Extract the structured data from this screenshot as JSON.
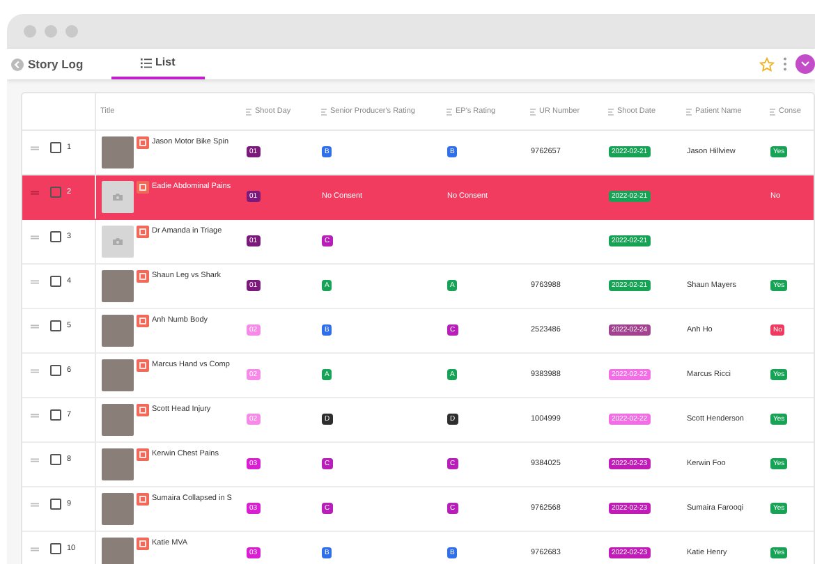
{
  "header": {
    "back_label": "Story Log",
    "tabs": [
      {
        "label": "List",
        "selected": true
      }
    ]
  },
  "table": {
    "columns": [
      {
        "label": "Title",
        "kind": "primary"
      },
      {
        "label": "Shoot Day",
        "kind": "field"
      },
      {
        "label": "Senior Producer's Rating",
        "kind": "field"
      },
      {
        "label": "EP's Rating",
        "kind": "field"
      },
      {
        "label": "UR Number",
        "kind": "field"
      },
      {
        "label": "Shoot Date",
        "kind": "field"
      },
      {
        "label": "Patient Name",
        "kind": "field"
      },
      {
        "label": "Conse",
        "kind": "field"
      }
    ],
    "rows": [
      {
        "number": "1",
        "checked": false,
        "highlighted": false,
        "thumbnail": {
          "kind": "photo"
        },
        "title": "Jason Motor Bike Spin",
        "shoot_day": {
          "text": "01",
          "color": "#7b1a7b"
        },
        "sp_rating": {
          "text": "B",
          "color": "#2f6fea"
        },
        "ep_rating": {
          "text": "B",
          "color": "#2f6fea"
        },
        "ur_number": "9762657",
        "shoot_date": {
          "text": "2022-02-21",
          "color": "#17a255"
        },
        "patient_name": "Jason Hillview",
        "consent": {
          "text": "Yes",
          "color": "#17a255"
        }
      },
      {
        "number": "2",
        "checked": false,
        "highlighted": true,
        "thumbnail": {
          "kind": "empty"
        },
        "title": "Eadie Abdominal Pains",
        "shoot_day": {
          "text": "01",
          "color": "#7b1a7b"
        },
        "sp_rating": {
          "text": "No Consent"
        },
        "ep_rating": {
          "text": "No Consent"
        },
        "shoot_date": {
          "text": "2022-02-21",
          "color": "#17a255"
        },
        "consent": {
          "text": "No"
        }
      },
      {
        "number": "3",
        "checked": false,
        "highlighted": false,
        "thumbnail": {
          "kind": "empty"
        },
        "title": "Dr Amanda in Triage",
        "shoot_day": {
          "text": "01",
          "color": "#7b1a7b"
        },
        "sp_rating": {
          "text": "C",
          "color": "#b81fb8"
        },
        "shoot_date": {
          "text": "2022-02-21",
          "color": "#17a255"
        }
      },
      {
        "number": "4",
        "checked": false,
        "highlighted": false,
        "thumbnail": {
          "kind": "photo"
        },
        "title": "Shaun Leg vs Shark",
        "shoot_day": {
          "text": "01",
          "color": "#7b1a7b"
        },
        "sp_rating": {
          "text": "A",
          "color": "#17a255"
        },
        "ep_rating": {
          "text": "A",
          "color": "#17a255"
        },
        "ur_number": "9763988",
        "shoot_date": {
          "text": "2022-02-21",
          "color": "#17a255"
        },
        "patient_name": "Shaun Mayers",
        "consent": {
          "text": "Yes",
          "color": "#17a255"
        }
      },
      {
        "number": "5",
        "checked": false,
        "highlighted": false,
        "thumbnail": {
          "kind": "photo"
        },
        "title": "Anh Numb Body",
        "shoot_day": {
          "text": "02",
          "color": "#f78ae8"
        },
        "sp_rating": {
          "text": "B",
          "color": "#2f6fea"
        },
        "ep_rating": {
          "text": "C",
          "color": "#b81fb8"
        },
        "ur_number": "2523486",
        "shoot_date": {
          "text": "2022-02-24",
          "color": "#a3428f"
        },
        "patient_name": "Anh Ho",
        "consent": {
          "text": "No",
          "color": "#f0395f"
        }
      },
      {
        "number": "6",
        "checked": false,
        "highlighted": false,
        "thumbnail": {
          "kind": "photo"
        },
        "title": "Marcus Hand vs Comp",
        "shoot_day": {
          "text": "02",
          "color": "#f78ae8"
        },
        "sp_rating": {
          "text": "A",
          "color": "#17a255"
        },
        "ep_rating": {
          "text": "A",
          "color": "#17a255"
        },
        "ur_number": "9383988",
        "shoot_date": {
          "text": "2022-02-22",
          "color": "#f26ee6"
        },
        "patient_name": "Marcus Ricci",
        "consent": {
          "text": "Yes",
          "color": "#17a255"
        }
      },
      {
        "number": "7",
        "checked": false,
        "highlighted": false,
        "thumbnail": {
          "kind": "photo"
        },
        "title": "Scott Head Injury",
        "shoot_day": {
          "text": "02",
          "color": "#f78ae8"
        },
        "sp_rating": {
          "text": "D",
          "color": "#2e2e2e"
        },
        "ep_rating": {
          "text": "D",
          "color": "#2e2e2e"
        },
        "ur_number": "1004999",
        "shoot_date": {
          "text": "2022-02-22",
          "color": "#f26ee6"
        },
        "patient_name": "Scott Henderson",
        "consent": {
          "text": "Yes",
          "color": "#17a255"
        }
      },
      {
        "number": "8",
        "checked": false,
        "highlighted": false,
        "thumbnail": {
          "kind": "photo"
        },
        "title": "Kerwin Chest Pains",
        "shoot_day": {
          "text": "03",
          "color": "#d81fd2"
        },
        "sp_rating": {
          "text": "C",
          "color": "#b81fb8"
        },
        "ep_rating": {
          "text": "C",
          "color": "#b81fb8"
        },
        "ur_number": "9384025",
        "shoot_date": {
          "text": "2022-02-23",
          "color": "#c21cb8"
        },
        "patient_name": "Kerwin Foo",
        "consent": {
          "text": "Yes",
          "color": "#17a255"
        }
      },
      {
        "number": "9",
        "checked": false,
        "highlighted": false,
        "thumbnail": {
          "kind": "photo"
        },
        "title": "Sumaira Collapsed in S",
        "shoot_day": {
          "text": "03",
          "color": "#d81fd2"
        },
        "sp_rating": {
          "text": "C",
          "color": "#b81fb8"
        },
        "ep_rating": {
          "text": "C",
          "color": "#b81fb8"
        },
        "ur_number": "9762568",
        "shoot_date": {
          "text": "2022-02-23",
          "color": "#c21cb8"
        },
        "patient_name": "Sumaira Farooqi",
        "consent": {
          "text": "Yes",
          "color": "#17a255"
        }
      },
      {
        "number": "10",
        "checked": false,
        "highlighted": false,
        "thumbnail": {
          "kind": "photo"
        },
        "title": "Katie MVA",
        "shoot_day": {
          "text": "03",
          "color": "#d81fd2"
        },
        "sp_rating": {
          "text": "B",
          "color": "#2f6fea"
        },
        "ep_rating": {
          "text": "B",
          "color": "#2f6fea"
        },
        "ur_number": "9762683",
        "shoot_date": {
          "text": "2022-02-23",
          "color": "#c21cb8"
        },
        "patient_name": "Katie Henry",
        "consent": {
          "text": "Yes",
          "color": "#17a255"
        }
      }
    ]
  }
}
